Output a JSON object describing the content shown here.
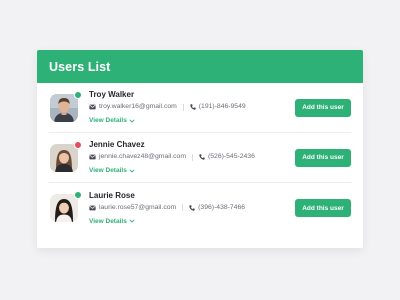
{
  "header": {
    "title": "Users List"
  },
  "colors": {
    "accent": "#2eb176",
    "status_online": "#2eb176",
    "status_busy": "#e84a5f"
  },
  "users": [
    {
      "name": "Troy Walker",
      "email": "troy.walker16@gmail.com",
      "phone": "(191)-846-9549",
      "status": "online",
      "details_label": "View Details",
      "add_label": "Add this user"
    },
    {
      "name": "Jennie Chavez",
      "email": "jennie.chavez48@gmail.com",
      "phone": "(526)-545-2436",
      "status": "busy",
      "details_label": "View Details",
      "add_label": "Add this user"
    },
    {
      "name": "Laurie Rose",
      "email": "laurie.rose57@gmail.com",
      "phone": "(396)-438-7466",
      "status": "online",
      "details_label": "View Details",
      "add_label": "Add this user"
    }
  ]
}
